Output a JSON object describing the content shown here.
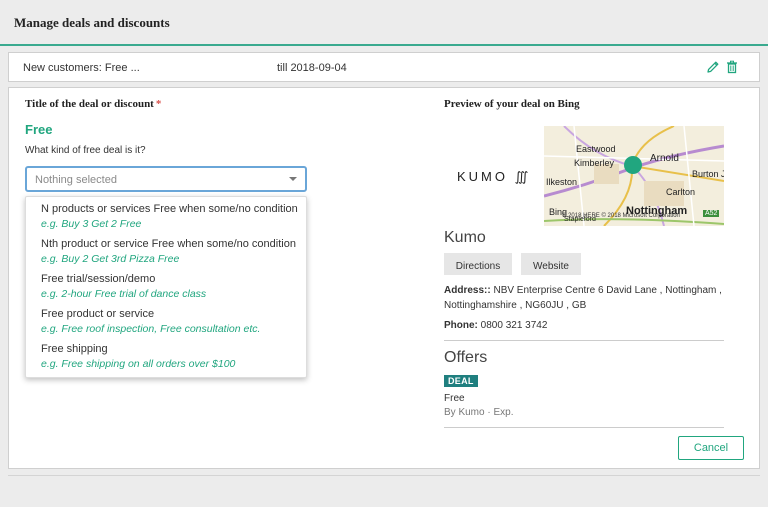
{
  "header": {
    "title": "Manage deals and discounts"
  },
  "deal_row": {
    "name": "New customers: Free ...",
    "till": "till 2018-09-04"
  },
  "form": {
    "title_label": "Title of the deal or discount",
    "required_mark": "*",
    "deal_title": "Free",
    "question": "What kind of free deal is it?",
    "select": {
      "selected": "Nothing selected"
    },
    "options": [
      {
        "title": "N products or services Free when some/no condition",
        "example": "e.g. Buy 3 Get 2 Free"
      },
      {
        "title": "Nth product or service Free when some/no condition",
        "example": "e.g. Buy 2 Get 3rd Pizza Free"
      },
      {
        "title": "Free trial/session/demo",
        "example": "e.g. 2-hour Free trial of dance class"
      },
      {
        "title": "Free product or service",
        "example": "e.g. Free roof inspection, Free consultation etc."
      },
      {
        "title": "Free shipping",
        "example": "e.g. Free shipping on all orders over $100"
      }
    ]
  },
  "preview": {
    "label": "Preview of your deal on Bing",
    "logo": "KUMO ∭",
    "map": {
      "places": [
        "Eastwood",
        "Kimberley",
        "Arnold",
        "Ilkeston",
        "Burton J",
        "Carlton",
        "Nottingham",
        "Stapleford"
      ],
      "bing": "Bing",
      "copyright": "© 2018 HERE © 2018 Microsoft Corporation",
      "road": "A52"
    },
    "business_name": "Kumo",
    "directions_label": "Directions",
    "website_label": "Website",
    "address_label": "Address::",
    "address_value": "NBV Enterprise Centre 6 David Lane , Nottingham , Nottinghamshire , NG60JU , GB",
    "phone_label": "Phone:",
    "phone_value": "0800 321 3742",
    "offers_heading": "Offers",
    "deal_badge": "DEAL",
    "offer_title": "Free",
    "offer_by": "By Kumo · Exp."
  },
  "actions": {
    "cancel_label": "Cancel"
  },
  "colors": {
    "accent": "#21a67f",
    "header_line": "#3aaa8f",
    "badge": "#1f7f7f",
    "required": "#d9534f",
    "focus_border": "#6aa6d8"
  }
}
